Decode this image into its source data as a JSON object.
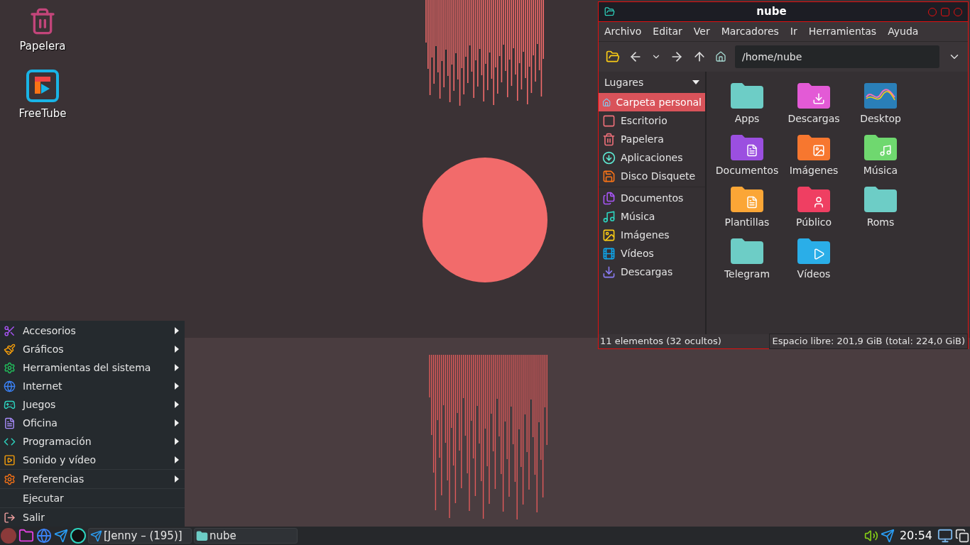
{
  "desktop_icons": [
    {
      "label": "Papelera",
      "kind": "trash"
    },
    {
      "label": "FreeTube",
      "kind": "app"
    }
  ],
  "start_menu": {
    "sections": [
      [
        {
          "label": "Accesorios",
          "kind": "accessories",
          "submenu": true
        },
        {
          "label": "Gráficos",
          "kind": "graphics",
          "submenu": true
        },
        {
          "label": "Herramientas del sistema",
          "kind": "system",
          "submenu": true
        },
        {
          "label": "Internet",
          "kind": "internet",
          "submenu": true
        },
        {
          "label": "Juegos",
          "kind": "games",
          "submenu": true
        },
        {
          "label": "Oficina",
          "kind": "office",
          "submenu": true
        },
        {
          "label": "Programación",
          "kind": "programming",
          "submenu": true
        },
        {
          "label": "Sonido y vídeo",
          "kind": "media",
          "submenu": true
        }
      ],
      [
        {
          "label": "Preferencias",
          "kind": "preferences",
          "submenu": true
        }
      ],
      [
        {
          "label": "Ejecutar",
          "kind": "none",
          "submenu": false
        }
      ],
      [
        {
          "label": "Salir",
          "kind": "logout",
          "submenu": false
        }
      ]
    ]
  },
  "window": {
    "title": "nube",
    "menu_bar": [
      "Archivo",
      "Editar",
      "Ver",
      "Marcadores",
      "Ir",
      "Herramientas",
      "Ayuda"
    ],
    "path": "/home/nube",
    "sidebar": {
      "heading": "Lugares",
      "sections": [
        [
          {
            "label": "Carpeta personal",
            "kind": "home",
            "selected": true
          },
          {
            "label": "Escritorio",
            "kind": "desktop",
            "selected": false
          },
          {
            "label": "Papelera",
            "kind": "trash",
            "selected": false
          },
          {
            "label": "Aplicaciones",
            "kind": "apps",
            "selected": false
          },
          {
            "label": "Disco Disquete",
            "kind": "floppy",
            "selected": false
          }
        ],
        [
          {
            "label": "Documentos",
            "kind": "documents",
            "selected": false
          },
          {
            "label": "Música",
            "kind": "music",
            "selected": false
          },
          {
            "label": "Imágenes",
            "kind": "images",
            "selected": false
          },
          {
            "label": "Vídeos",
            "kind": "videos",
            "selected": false
          },
          {
            "label": "Descargas",
            "kind": "downloads",
            "selected": false
          }
        ]
      ]
    },
    "files": [
      {
        "label": "Apps",
        "kind": "folder",
        "color": "#6dcdc6"
      },
      {
        "label": "Descargas",
        "kind": "download",
        "color": "#e35ad6"
      },
      {
        "label": "Desktop",
        "kind": "thumbnail",
        "color": "#2a7fb8"
      },
      {
        "label": "Documentos",
        "kind": "document",
        "color": "#9b4fe0"
      },
      {
        "label": "Imágenes",
        "kind": "image",
        "color": "#f7772f"
      },
      {
        "label": "Música",
        "kind": "music",
        "color": "#6fd86f"
      },
      {
        "label": "Plantillas",
        "kind": "template",
        "color": "#fba636"
      },
      {
        "label": "Público",
        "kind": "user",
        "color": "#ef3f62"
      },
      {
        "label": "Roms",
        "kind": "folder",
        "color": "#6dcdc6"
      },
      {
        "label": "Telegram",
        "kind": "folder",
        "color": "#6dcdc6"
      },
      {
        "label": "Vídeos",
        "kind": "video",
        "color": "#2aaee8"
      }
    ],
    "status_left": "11 elementos (32 ocultos)",
    "status_right": "Espacio libre: 201,9 GiB (total: 224,0 GiB)"
  },
  "taskbar": {
    "tasks": [
      {
        "label": "[Jenny – (195)]",
        "kind": "telegram"
      },
      {
        "label": "nube",
        "kind": "folder"
      }
    ],
    "clock": "20:54"
  }
}
